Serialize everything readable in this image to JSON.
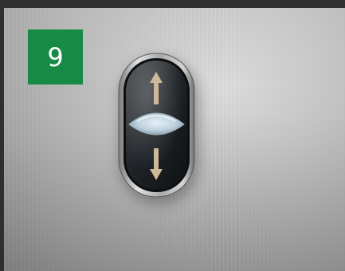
{
  "floor_indicator": {
    "number": "9",
    "color": "#178a45"
  },
  "call_button": {
    "type": "double pushbutton",
    "top_symbol": "up-arrow-icon",
    "bottom_symbol": "down-arrow-icon",
    "bezel_color": "#b9b9b9",
    "button_color": "#1f2326",
    "arrow_color": "#cdb89a",
    "lens_color": "#bcd0dc"
  }
}
